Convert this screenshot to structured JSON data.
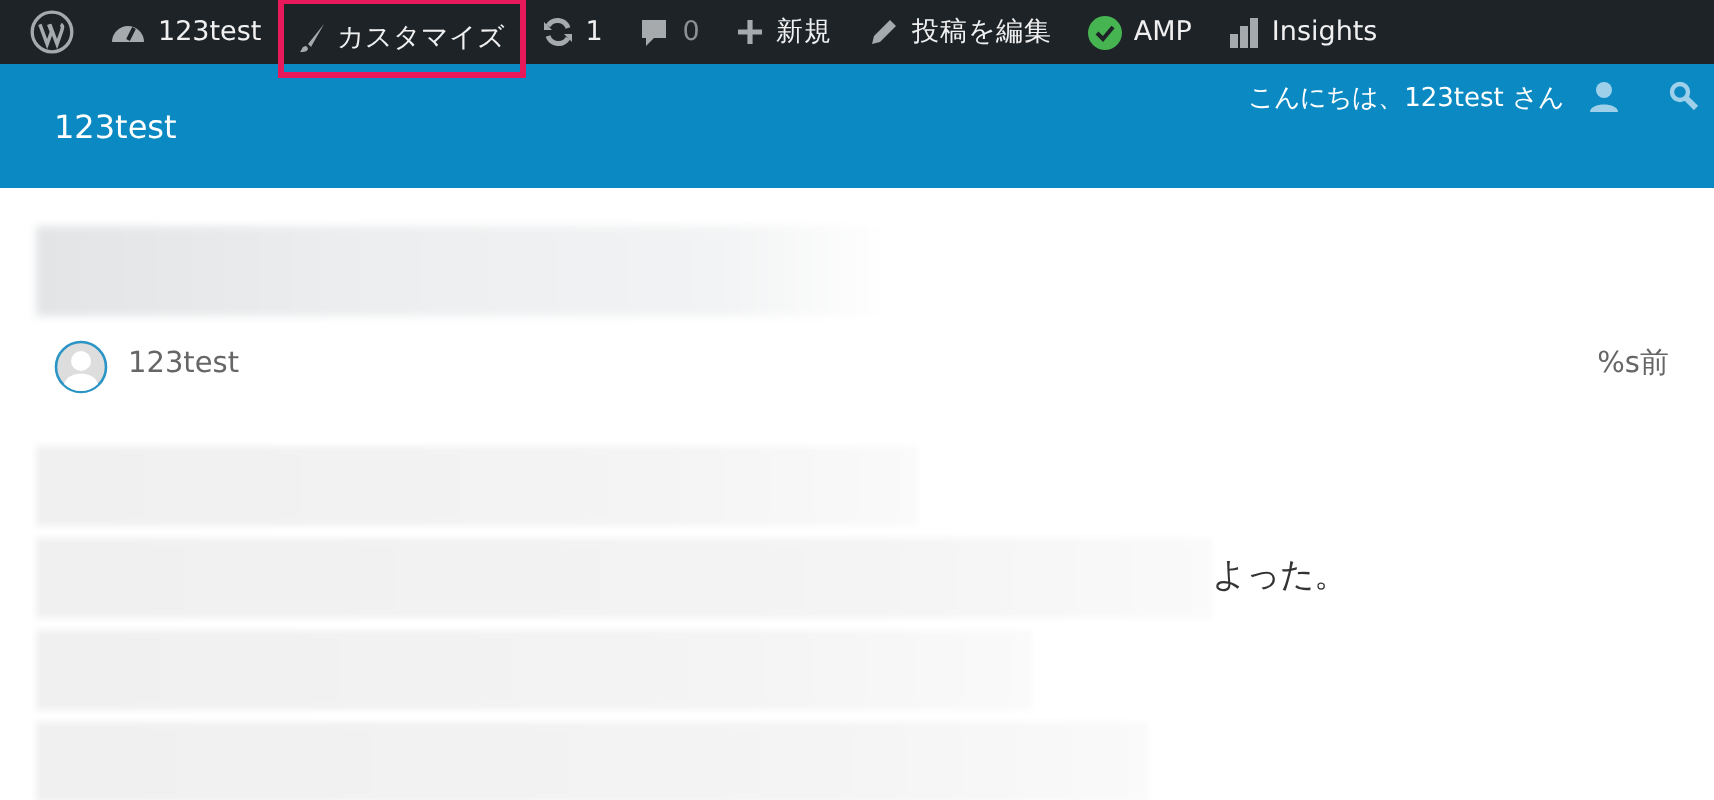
{
  "admin_bar": {
    "items": [
      {
        "kind": "logo"
      },
      {
        "kind": "gauge",
        "label": "123test",
        "highlighted": false
      },
      {
        "kind": "brush",
        "label": "カスタマイズ",
        "highlighted": true
      },
      {
        "kind": "refresh",
        "label": "1",
        "highlighted": false
      },
      {
        "kind": "comment",
        "label": "0",
        "highlighted": false
      },
      {
        "kind": "plus",
        "label": "新規",
        "highlighted": false
      },
      {
        "kind": "pencil",
        "label": "投稿を編集",
        "highlighted": false
      },
      {
        "kind": "check",
        "label": "AMP",
        "highlighted": false
      },
      {
        "kind": "bars",
        "label": "Insights",
        "highlighted": false
      }
    ]
  },
  "header": {
    "site_title": "123test",
    "greeting": "こんにちは、123test さん"
  },
  "post": {
    "title_redacted": true,
    "author": "123test",
    "time": "%s前",
    "paragraphs": [
      {
        "redacted": true
      },
      {
        "redacted": true,
        "tail": "よった。"
      },
      {
        "redacted": true
      },
      {
        "redacted": true
      }
    ]
  }
}
